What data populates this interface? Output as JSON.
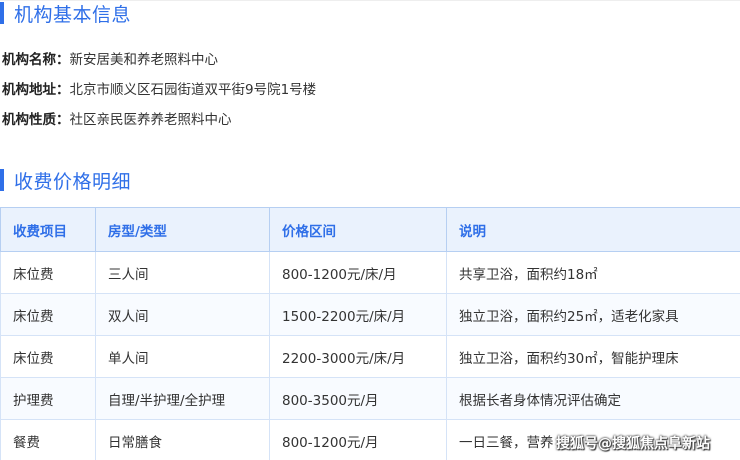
{
  "basic_info": {
    "title": "机构基本信息",
    "rows": [
      {
        "label": "机构名称：",
        "value": "新安居美和养老照料中心"
      },
      {
        "label": "机构地址：",
        "value": "北京市顺义区石园街道双平街9号院1号楼"
      },
      {
        "label": "机构性质：",
        "value": "社区亲民医养养老照料中心"
      }
    ]
  },
  "fees": {
    "title": "收费价格明细",
    "headers": [
      "收费项目",
      "房型/类型",
      "价格区间",
      "说明"
    ],
    "rows": [
      [
        "床位费",
        "三人间",
        "800-1200元/床/月",
        "共享卫浴，面积约18㎡"
      ],
      [
        "床位费",
        "双人间",
        "1500-2200元/床/月",
        "独立卫浴，面积约25㎡，适老化家具"
      ],
      [
        "床位费",
        "单人间",
        "2200-3000元/床/月",
        "独立卫浴，面积约30㎡，智能护理床"
      ],
      [
        "护理费",
        "自理/半护理/全护理",
        "800-3500元/月",
        "根据长者身体情况评估确定"
      ],
      [
        "餐费",
        "日常膳食",
        "800-1200元/月",
        "一日三餐，营养"
      ]
    ]
  },
  "watermark": "搜狐号@搜狐焦点阜新站",
  "colors": {
    "accent": "#2f6fe8",
    "header_bg": "#eaf2fd",
    "border": "#d5e3f7"
  }
}
